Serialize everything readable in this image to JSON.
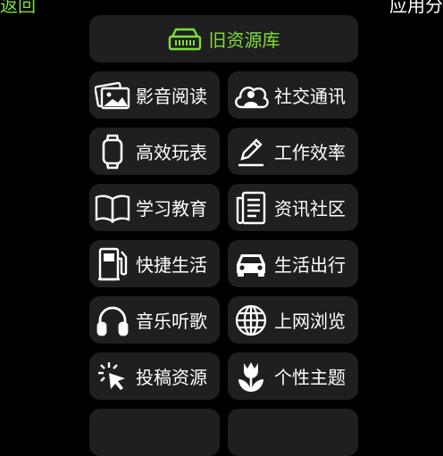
{
  "header": {
    "back_label": "返回",
    "title_partial": "应用分"
  },
  "legacy_button": {
    "label": "旧资源库",
    "icon": "archive-icon",
    "color": "#7dde3c"
  },
  "categories": [
    {
      "label": "影音阅读",
      "icon": "media-icon"
    },
    {
      "label": "社交通讯",
      "icon": "people-cloud-icon"
    },
    {
      "label": "高效玩表",
      "icon": "watch-icon"
    },
    {
      "label": "工作效率",
      "icon": "pencil-icon"
    },
    {
      "label": "学习教育",
      "icon": "book-icon"
    },
    {
      "label": "资讯社区",
      "icon": "news-icon"
    },
    {
      "label": "快捷生活",
      "icon": "fuel-icon"
    },
    {
      "label": "生活出行",
      "icon": "car-icon"
    },
    {
      "label": "音乐听歌",
      "icon": "headphones-icon"
    },
    {
      "label": "上网浏览",
      "icon": "globe-icon"
    },
    {
      "label": "投稿资源",
      "icon": "click-icon"
    },
    {
      "label": "个性主题",
      "icon": "tulip-icon"
    }
  ]
}
